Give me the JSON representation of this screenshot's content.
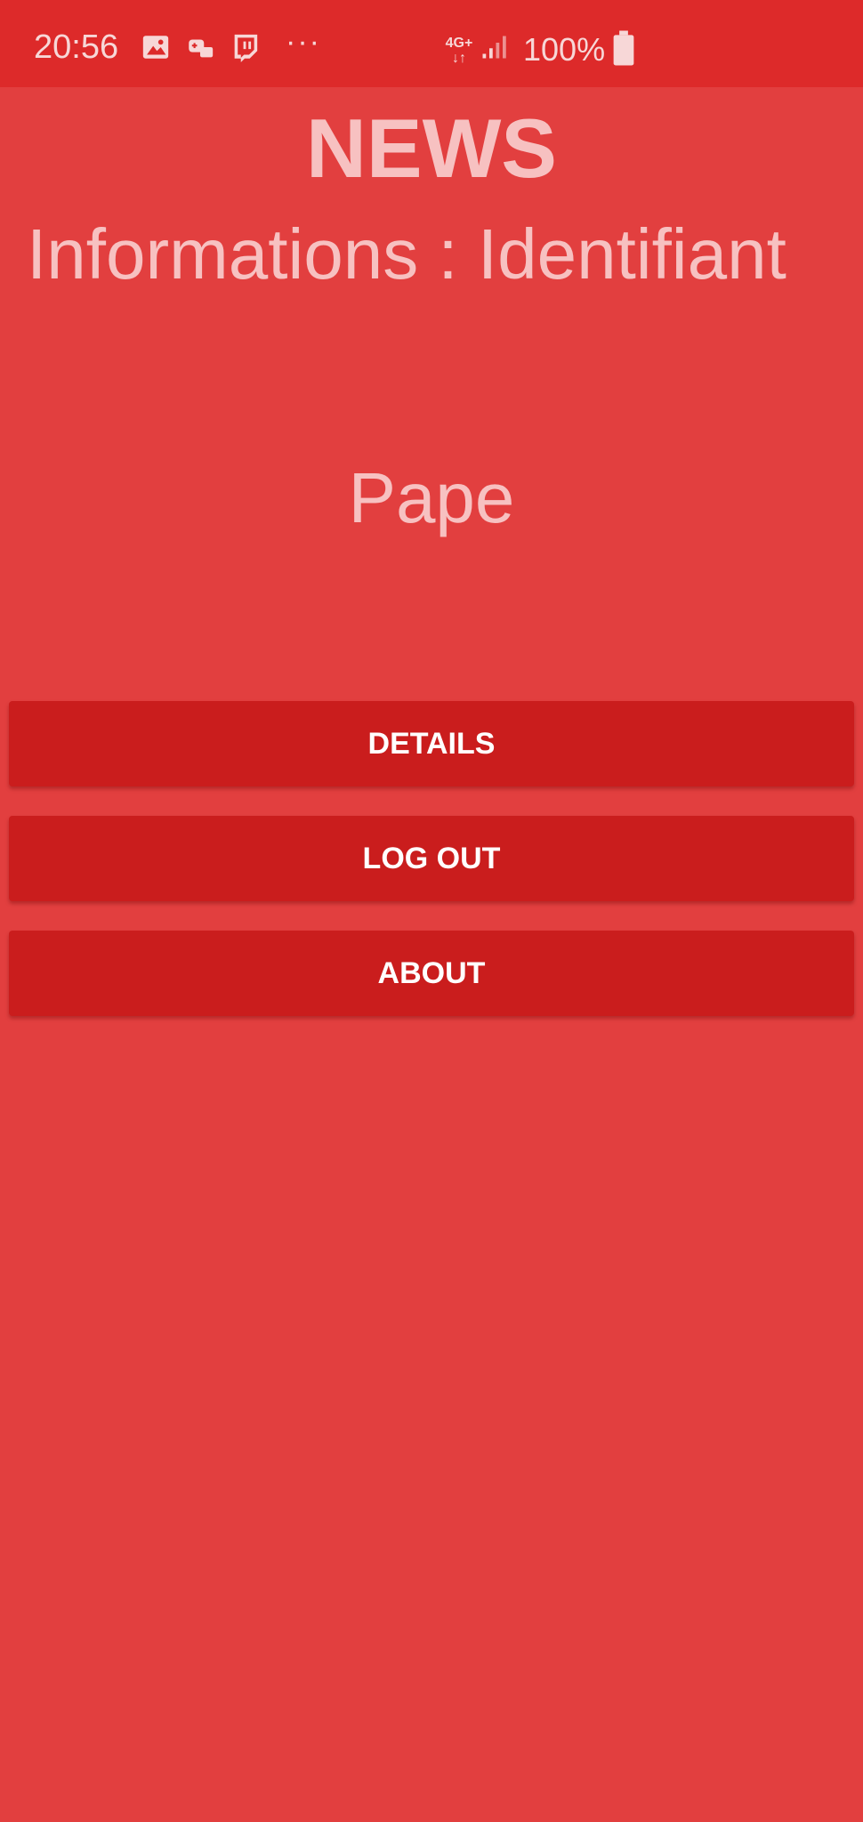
{
  "status_bar": {
    "time": "20:56",
    "network_type": "4G+",
    "battery": "100%",
    "icons": [
      "image-icon",
      "game-controller-icon",
      "twitch-icon",
      "more-dots-icon",
      "data-arrows-icon",
      "signal-icon",
      "battery-icon"
    ],
    "overflow_dots": "···"
  },
  "app": {
    "title": "NEWS",
    "info_heading": "Informations : Identifiant",
    "identifier": "Pape"
  },
  "buttons": {
    "details": "DETAILS",
    "logout": "LOG OUT",
    "about": "ABOUT"
  },
  "colors": {
    "background": "#e23f3f",
    "status_bar": "#dd2a2a",
    "button": "#ca1d1d",
    "text_light": "#f7c1c1"
  }
}
